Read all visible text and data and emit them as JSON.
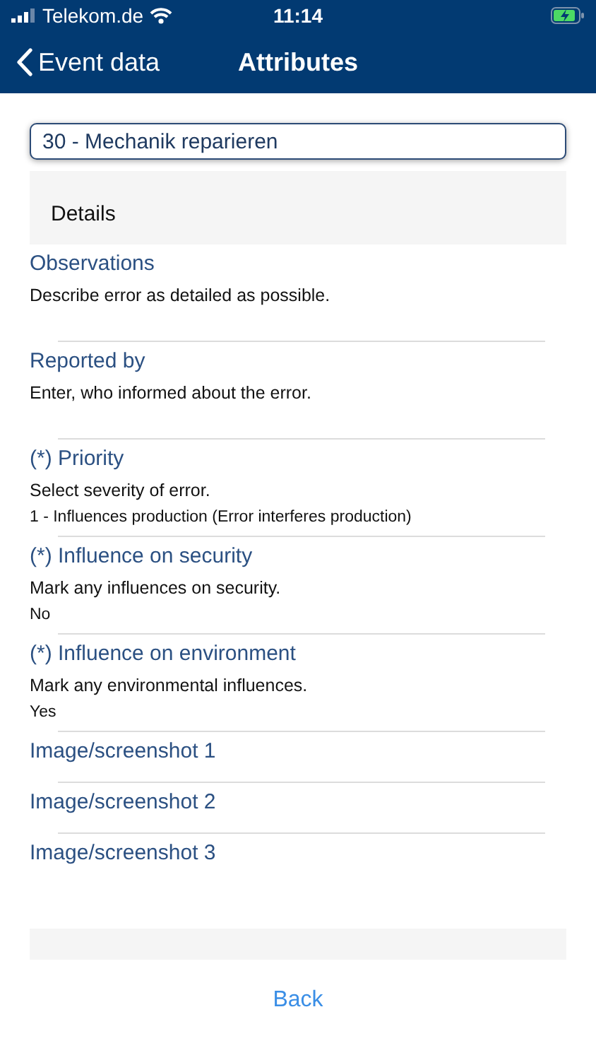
{
  "status_bar": {
    "carrier": "Telekom.de",
    "time": "11:14",
    "charging": true
  },
  "nav_bar": {
    "back_label": "Event data",
    "title": "Attributes"
  },
  "event_field": {
    "value": "30 - Mechanik reparieren"
  },
  "section": {
    "title": "Details"
  },
  "fields": [
    {
      "kind": "text",
      "label": "Observations",
      "hint": "Describe error as detailed as possible."
    },
    {
      "kind": "text",
      "label": "Reported by",
      "hint": "Enter, who informed about the error."
    },
    {
      "kind": "select",
      "label": "(*) Priority",
      "hint": "Select severity of error.",
      "value": "1 - Influences production (Error interferes production)"
    },
    {
      "kind": "select",
      "label": "(*) Influence on security",
      "hint": "Mark any influences on security.",
      "value": "No"
    },
    {
      "kind": "select",
      "label": "(*) Influence on environment",
      "hint": "Mark any environmental influences.",
      "value": "Yes"
    },
    {
      "kind": "image",
      "label": "Image/screenshot 1"
    },
    {
      "kind": "image",
      "label": "Image/screenshot 2"
    },
    {
      "kind": "image",
      "label": "Image/screenshot 3"
    }
  ],
  "footer": {
    "button": "Back"
  }
}
